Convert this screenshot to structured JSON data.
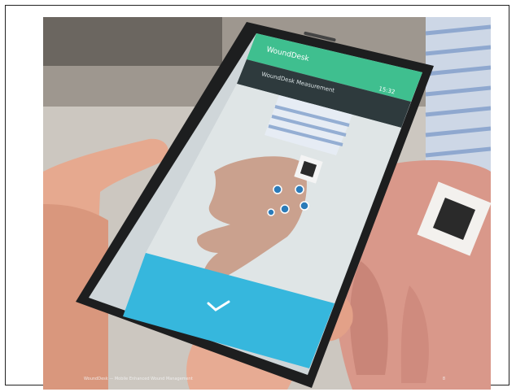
{
  "app": {
    "brand": "WoundDesk",
    "screen_title": "WoundDesk Measurement",
    "status_time": "15:32",
    "confirm_icon": "checkmark-icon"
  },
  "caption": "WoundDesk — Mobile Enhanced Wound Management",
  "page_number": "8",
  "colors": {
    "app_bar": "#3fbf8f",
    "toolbar": "#2e3a3d",
    "confirm_bar": "#36b7dd",
    "phone_body": "#1d1e1f"
  }
}
